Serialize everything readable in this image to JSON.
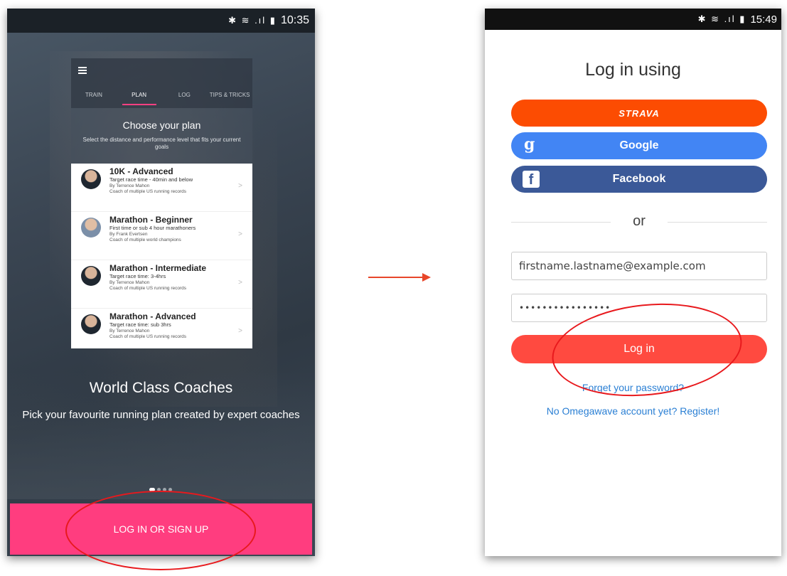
{
  "left_screen": {
    "status_bar": {
      "time": "10:35",
      "icons": "✱ ≋ .ıl ▮"
    },
    "tabs": [
      "TRAIN",
      "PLAN",
      "LOG",
      "TIPS & TRICKS"
    ],
    "active_tab": "PLAN",
    "choose_title": "Choose your plan",
    "choose_subtitle": "Select the distance and performance level that fits your current goals",
    "plans": [
      {
        "title": "10K - Advanced",
        "desc": "Target race time - 40min and below",
        "coach": "By Terrence Mahon",
        "coach_desc": "Coach of multiple US running records"
      },
      {
        "title": "Marathon - Beginner",
        "desc": "First time or sub 4 hour marathoners",
        "coach": "By Frank Evertsen",
        "coach_desc": "Coach of multiple world champions"
      },
      {
        "title": "Marathon - Intermediate",
        "desc": "Target race time: 3-4hrs",
        "coach": "By Terrence Mahon",
        "coach_desc": "Coach of multiple US running records"
      },
      {
        "title": "Marathon - Advanced",
        "desc": "Target race time: sub 3hrs",
        "coach": "By Terrence Mahon",
        "coach_desc": "Coach of multiple US running records"
      }
    ],
    "headline": "World Class Coaches",
    "subheadline": "Pick your favourite running plan created by expert coaches",
    "cta_label": "LOG IN OR SIGN UP"
  },
  "right_screen": {
    "status_bar": {
      "time": "15:49",
      "icons": "✱ ≋ .ıl ▮"
    },
    "title": "Log in using",
    "strava_label": "STRAVA",
    "google_label": "Google",
    "facebook_label": "Facebook",
    "or_label": "or",
    "email_value": "firstname.lastname@example.com",
    "password_value": "••••••••••••••••",
    "login_label": "Log in",
    "forgot_label": "Forget your password?",
    "register_label": "No Omegawave account yet? Register!"
  },
  "colors": {
    "cta_pink": "#ff3d7f",
    "strava": "#fc4c02",
    "google": "#4285f4",
    "facebook": "#3b5998",
    "login_red": "#ff4a40",
    "highlight_red": "#e8191d",
    "link_blue": "#2a7fd4"
  }
}
